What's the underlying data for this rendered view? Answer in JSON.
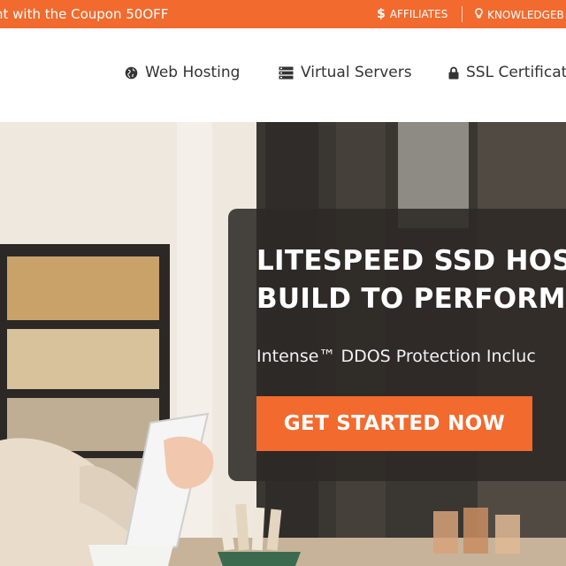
{
  "topbar": {
    "promo_text": "nt with the Coupon 50OFF",
    "links": [
      {
        "label": "AFFILIATES",
        "icon": "dollar-icon"
      },
      {
        "label": "KNOWLEDGEB",
        "icon": "lightbulb-icon"
      }
    ],
    "accent_color": "#f26a2e"
  },
  "nav": {
    "items": [
      {
        "label": "Web Hosting",
        "icon": "globe-icon"
      },
      {
        "label": "Virtual Servers",
        "icon": "server-icon"
      },
      {
        "label": "SSL Certificate",
        "icon": "lock-icon"
      }
    ]
  },
  "hero": {
    "headline_line1": "LITESPEED SSD HOS",
    "headline_line2": "BUILD TO PERFORM",
    "subtitle": "Intense™ DDOS Protection Incluc",
    "cta_label": "GET STARTED NOW"
  }
}
